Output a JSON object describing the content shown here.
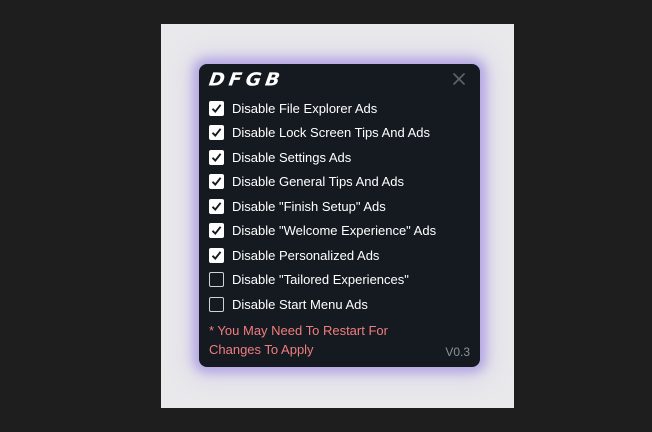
{
  "window": {
    "logo_text": "DFGB",
    "close_icon": "close-icon",
    "options": [
      {
        "label": "Disable File Explorer Ads",
        "checked": true
      },
      {
        "label": "Disable Lock Screen Tips And Ads",
        "checked": true
      },
      {
        "label": "Disable Settings Ads",
        "checked": true
      },
      {
        "label": "Disable General Tips And Ads",
        "checked": true
      },
      {
        "label": "Disable \"Finish Setup\" Ads",
        "checked": true
      },
      {
        "label": "Disable \"Welcome Experience\" Ads",
        "checked": true
      },
      {
        "label": "Disable Personalized Ads",
        "checked": true
      },
      {
        "label": "Disable \"Tailored Experiences\"",
        "checked": false
      },
      {
        "label": "Disable Start Menu Ads",
        "checked": false
      }
    ],
    "restart_note": "* You May Need To Restart For Changes To Apply",
    "version": "V0.3"
  },
  "colors": {
    "window_bg": "#151a21",
    "note": "#f07d7d",
    "glow": "#9682dc"
  }
}
